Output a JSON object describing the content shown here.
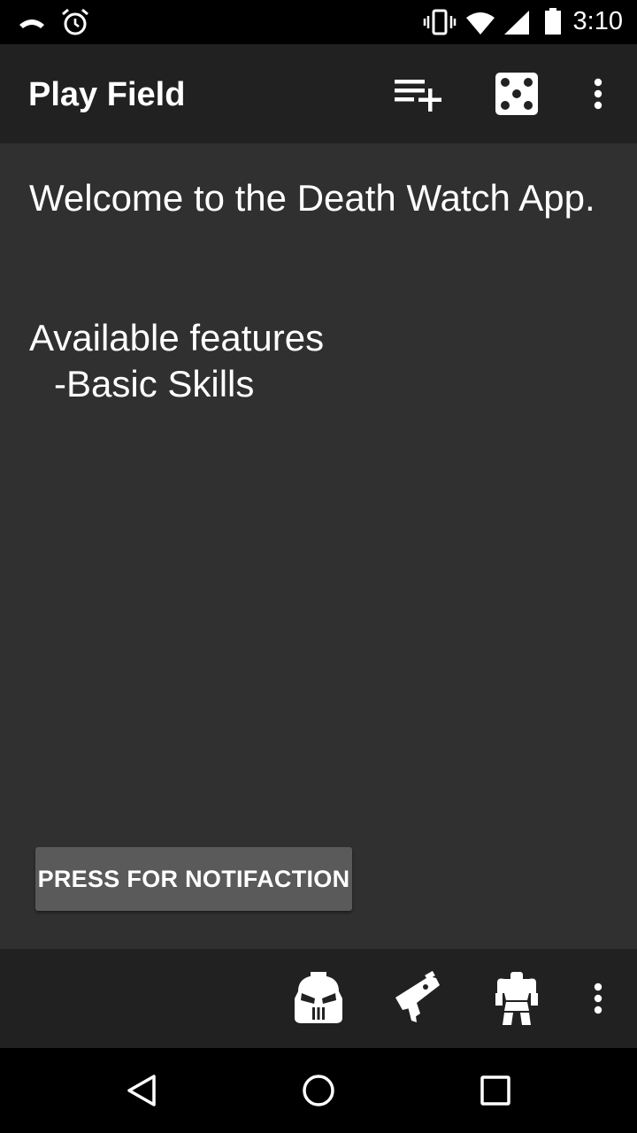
{
  "status_bar": {
    "time": "3:10",
    "icons": [
      "missed-call-icon",
      "alarm-icon",
      "vibrate-icon",
      "wifi-icon",
      "signal-icon",
      "battery-icon"
    ]
  },
  "app_bar": {
    "title": "Play Field",
    "actions": [
      "playlist-add-icon",
      "dice-icon",
      "overflow-menu-icon"
    ]
  },
  "content": {
    "welcome_text": "Welcome to the Death Watch App.",
    "features_heading": "Available features",
    "features": [
      "-Basic Skills"
    ]
  },
  "notify_button": {
    "label": "PRESS FOR NOTIFACTION"
  },
  "bottom_bar": {
    "actions": [
      "helmet-icon",
      "bolter-icon",
      "armor-icon",
      "overflow-menu-icon"
    ]
  },
  "nav_bar": {
    "buttons": [
      "back-icon",
      "home-icon",
      "recents-icon"
    ]
  },
  "colors": {
    "status_bar": "#000000",
    "app_bar": "#212121",
    "content_bg": "#303030",
    "button_bg": "#5a5a5a",
    "text": "#ffffff"
  }
}
